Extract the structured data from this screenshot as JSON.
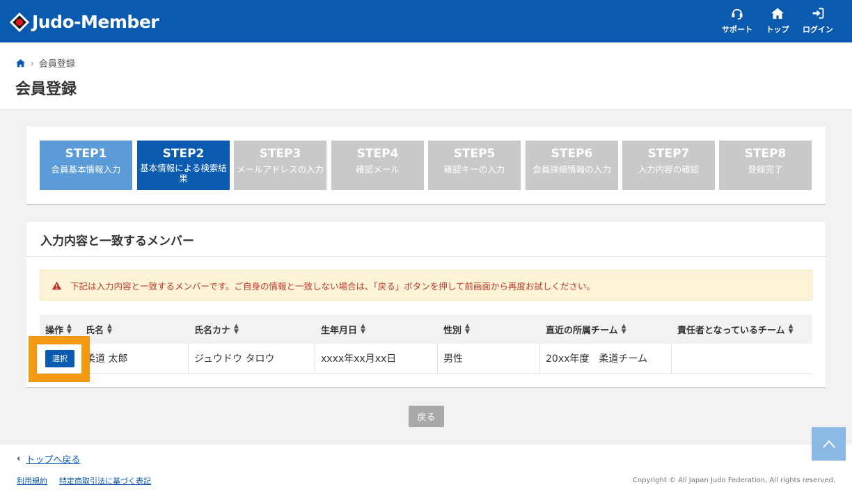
{
  "header": {
    "logo_text": "Judo-Member",
    "nav": [
      {
        "label": "サポート",
        "icon": "headset-icon"
      },
      {
        "label": "トップ",
        "icon": "home-icon"
      },
      {
        "label": "ログイン",
        "icon": "login-icon"
      }
    ]
  },
  "breadcrumb": {
    "home_icon": "home-icon",
    "current": "会員登録"
  },
  "page_title": "会員登録",
  "steps": [
    {
      "num": "STEP1",
      "label": "会員基本情報入力",
      "state": "done"
    },
    {
      "num": "STEP2",
      "label": "基本情報による検索結果",
      "state": "active"
    },
    {
      "num": "STEP3",
      "label": "メールアドレスの入力",
      "state": "pending"
    },
    {
      "num": "STEP4",
      "label": "確認メール",
      "state": "pending"
    },
    {
      "num": "STEP5",
      "label": "確認キーの入力",
      "state": "pending"
    },
    {
      "num": "STEP6",
      "label": "会員詳細情報の入力",
      "state": "pending"
    },
    {
      "num": "STEP7",
      "label": "入力内容の確認",
      "state": "pending"
    },
    {
      "num": "STEP8",
      "label": "登録完了",
      "state": "pending"
    }
  ],
  "results": {
    "title": "入力内容と一致するメンバー",
    "alert": "下記は入力内容と一致するメンバーです。ご自身の情報と一致しない場合は、「戻る」ボタンを押して前画面から再度お試しください。",
    "columns": [
      "操作",
      "氏名",
      "氏名カナ",
      "生年月日",
      "性別",
      "直近の所属チーム",
      "責任者となっているチーム"
    ],
    "rows": [
      {
        "action": "選択",
        "name": "柔道 太郎",
        "kana": "ジュウドウ タロウ",
        "birth": "xxxx年xx月xx日",
        "gender": "男性",
        "team": "20xx年度　柔道チーム",
        "responsible": ""
      }
    ]
  },
  "back_button": "戻る",
  "footer": {
    "back_top": "トップへ戻る",
    "links": [
      "利用規約",
      "特定商取引法に基づく表記"
    ],
    "copyright": "Copyright © All Japan Judo Federation, All rights reserved."
  },
  "colors": {
    "primary": "#0a5ab0",
    "step_done": "#5a9bd8",
    "step_pending": "#c9c9c9",
    "highlight": "#f39a10",
    "alert_bg": "#fdf3d6",
    "alert_text": "#c0392b"
  }
}
